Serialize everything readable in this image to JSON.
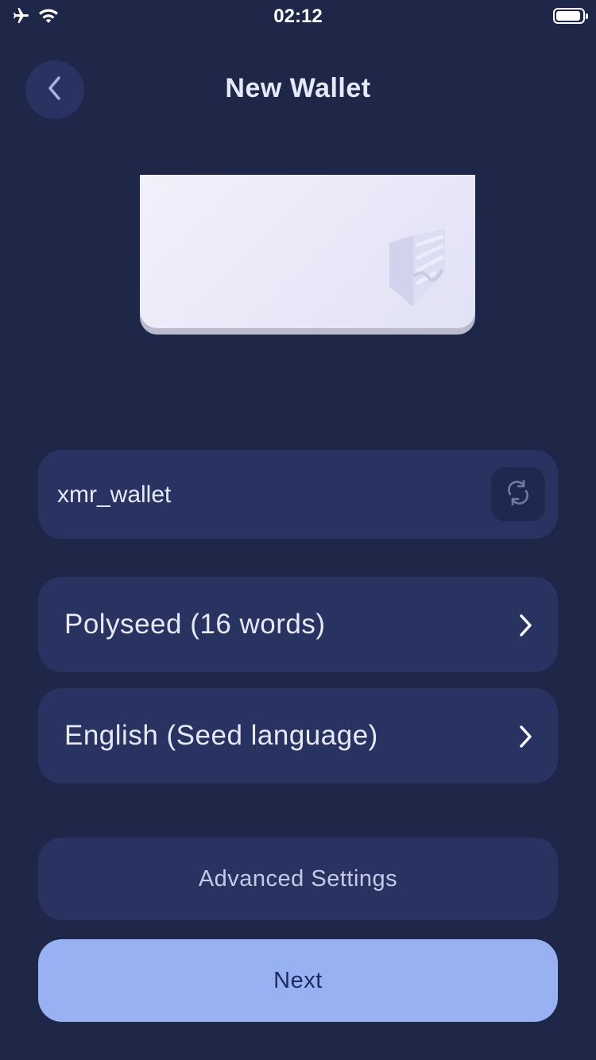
{
  "status_bar": {
    "time": "02:12",
    "icons": [
      "airplane-icon",
      "wifi-icon",
      "battery-icon"
    ]
  },
  "header": {
    "title": "New Wallet",
    "back_icon": "chevron-left-icon"
  },
  "wallet_name": {
    "value": "xmr_wallet",
    "refresh_icon": "refresh-icon"
  },
  "seed_type": {
    "label": "Polyseed (16 words)",
    "icon": "chevron-right-icon"
  },
  "seed_language": {
    "label": "English (Seed language)",
    "icon": "chevron-right-icon"
  },
  "buttons": {
    "advanced": "Advanced Settings",
    "next": "Next"
  },
  "colors": {
    "background": "#1e2748",
    "card_surface": "#283362",
    "accent": "#98b1f3",
    "text": "#e6e9f7"
  }
}
